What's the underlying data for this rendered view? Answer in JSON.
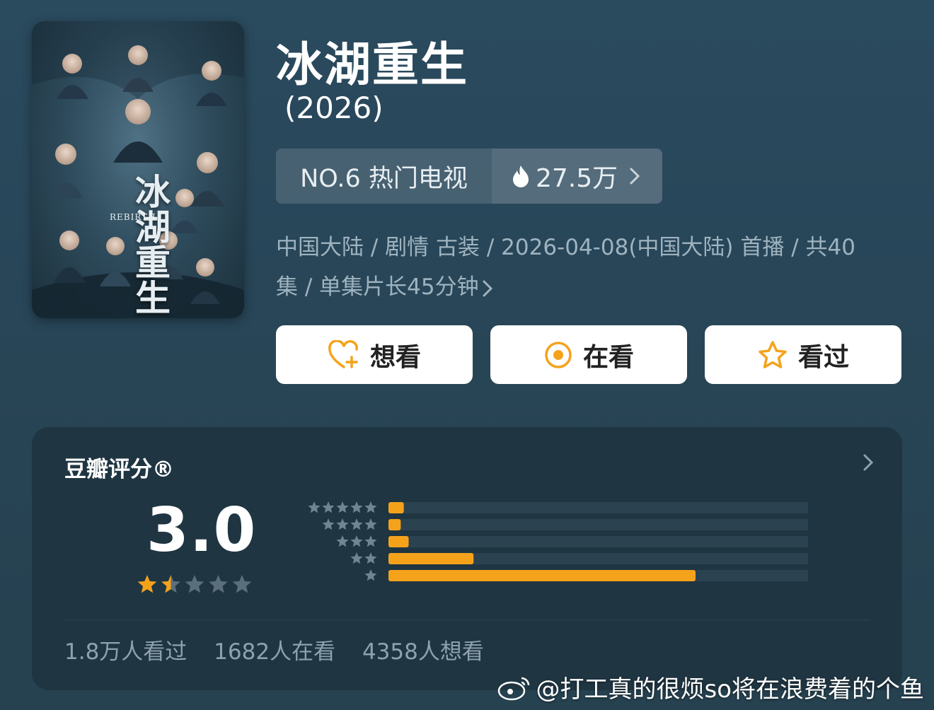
{
  "poster": {
    "title_art": "冰湖重生",
    "title_sub": "REBIRTH"
  },
  "title": "冰湖重生",
  "year": "(2026)",
  "rank": {
    "label": "NO.6 热门电视",
    "heat": "27.5万",
    "icon": "flame-icon"
  },
  "meta": {
    "line1": "中国大陆 / 剧情 古装 / 2026-04-08(中国大陆) 首播 / 共40",
    "line2": "集 / 单集片长45分钟"
  },
  "actions": [
    {
      "label": "想看",
      "icon": "heart-plus-icon"
    },
    {
      "label": "在看",
      "icon": "target-icon"
    },
    {
      "label": "看过",
      "icon": "star-outline-icon"
    }
  ],
  "rating": {
    "title": "豆瓣评分®",
    "score": "3.0",
    "stars_filled": 1.5,
    "stars_total": 5,
    "distribution": [
      {
        "stars": 5,
        "fraction": 0.035
      },
      {
        "stars": 4,
        "fraction": 0.028
      },
      {
        "stars": 3,
        "fraction": 0.046
      },
      {
        "stars": 2,
        "fraction": 0.194
      },
      {
        "stars": 1,
        "fraction": 0.7
      }
    ],
    "stats": {
      "watched": "1.8万人看过",
      "watching": "1682人在看",
      "want": "4358人想看"
    }
  },
  "watermark": "@打工真的很烦so将在浪费着的个鱼",
  "colors": {
    "accent": "#f5a21b",
    "card": "#1f3542",
    "bar_track": "#2b4250"
  }
}
